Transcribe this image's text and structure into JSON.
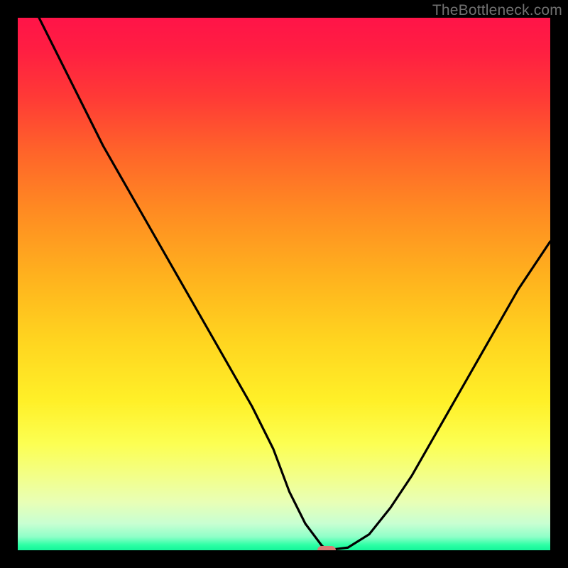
{
  "watermark": "TheBottleneck.com",
  "colors": {
    "background": "#000000",
    "curve": "#000000",
    "marker": "#d87b75",
    "watermark_text": "#707070"
  },
  "chart_data": {
    "type": "line",
    "title": "",
    "xlabel": "",
    "ylabel": "",
    "xlim": [
      0,
      100
    ],
    "ylim": [
      0,
      100
    ],
    "x": [
      4,
      8,
      12,
      16,
      20,
      24,
      28,
      32,
      36,
      40,
      44,
      48,
      51,
      54,
      57,
      58,
      62,
      66,
      70,
      74,
      78,
      82,
      86,
      90,
      94,
      98,
      100
    ],
    "values": [
      100,
      92,
      84,
      76,
      69,
      62,
      55,
      48,
      41,
      34,
      27,
      19,
      11,
      5,
      1,
      0,
      0.5,
      3,
      8,
      14,
      21,
      28,
      35,
      42,
      49,
      55,
      58
    ],
    "marker": {
      "x": 58,
      "y": 0
    },
    "annotations": []
  }
}
